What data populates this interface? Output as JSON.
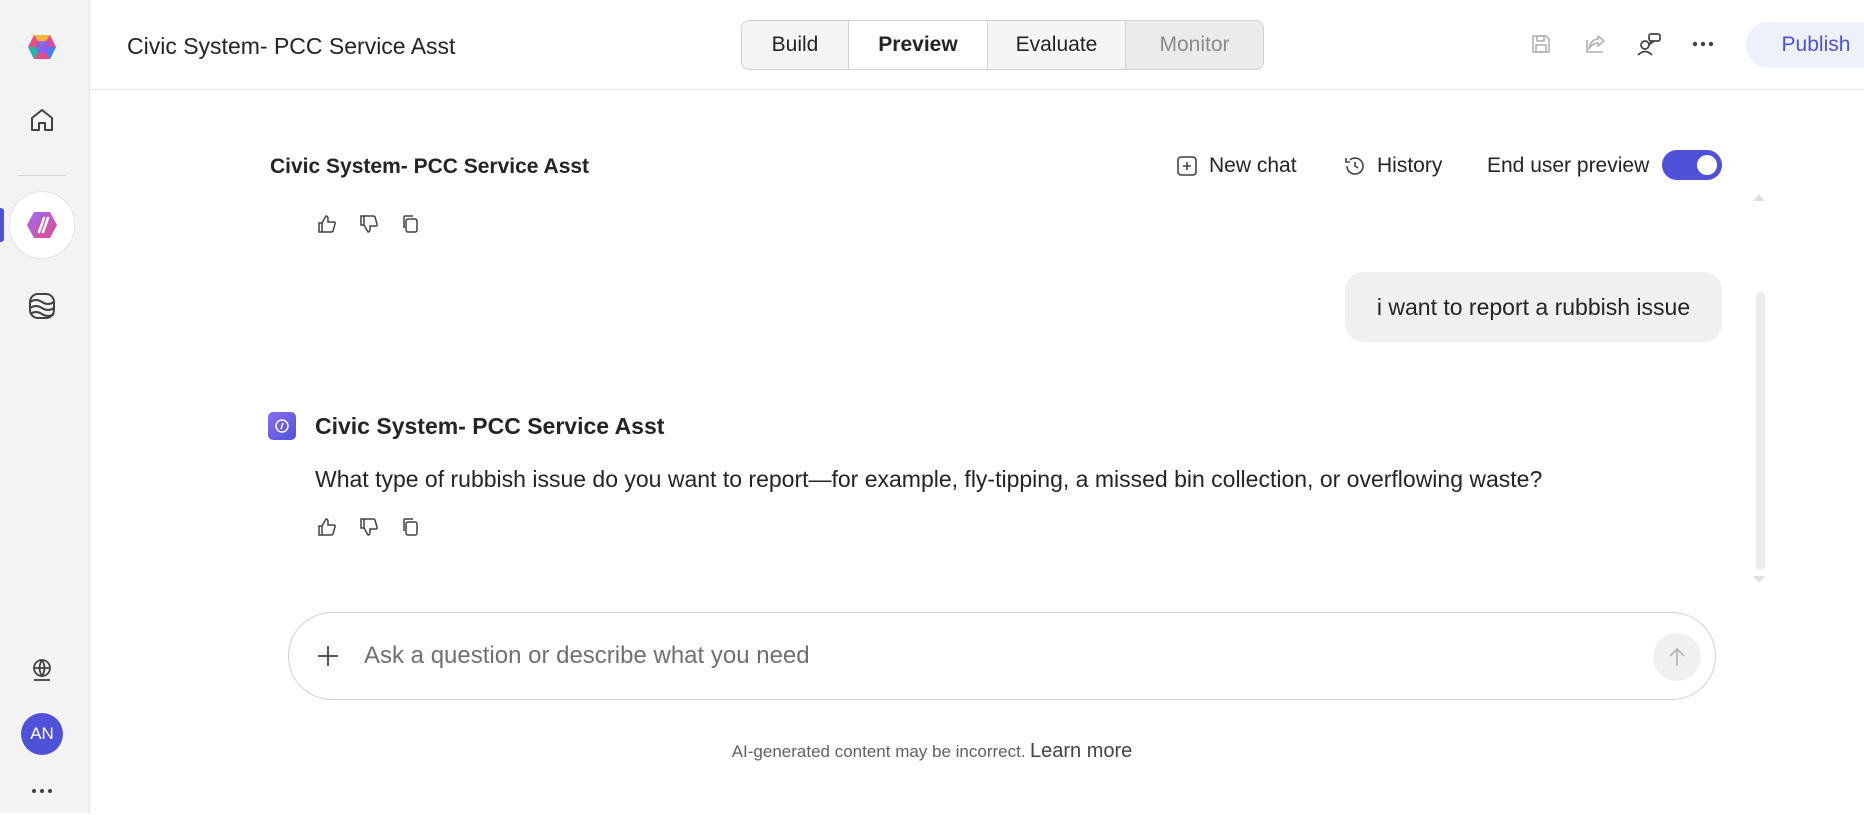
{
  "app": {
    "title": "Civic System- PCC Service Asst"
  },
  "tabs": [
    {
      "label": "Build"
    },
    {
      "label": "Preview"
    },
    {
      "label": "Evaluate"
    },
    {
      "label": "Monitor"
    }
  ],
  "toolbar": {
    "publish_label": "Publish"
  },
  "user": {
    "initials": "AN"
  },
  "chat": {
    "title": "Civic System- PCC Service Asst",
    "new_chat_label": "New chat",
    "history_label": "History",
    "end_user_preview_label": "End user preview",
    "end_user_preview_on": true,
    "messages": [
      {
        "role": "user",
        "text": "i want to report a rubbish issue"
      },
      {
        "role": "bot",
        "sender": "Civic System- PCC Service Asst",
        "text": "What type of rubbish issue do you want to report—for example, fly-tipping, a missed bin collection, or overflowing waste?"
      }
    ]
  },
  "composer": {
    "placeholder": "Ask a question or describe what you need",
    "value": ""
  },
  "footer": {
    "disclaimer": "AI-generated content may be incorrect.",
    "learn_more": "Learn more"
  },
  "colors": {
    "accent": "#4f52d9",
    "rail_bg": "#f3f3f3"
  }
}
